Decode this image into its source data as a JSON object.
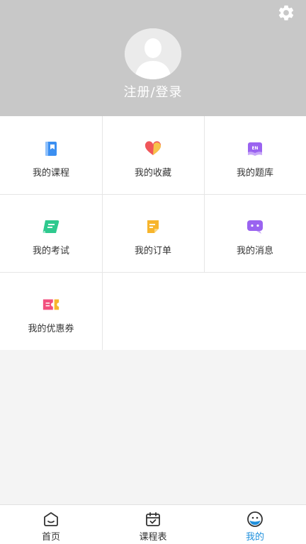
{
  "header": {
    "login_text": "注册/登录"
  },
  "grid": {
    "items": [
      {
        "label": "我的课程",
        "icon": "book-icon",
        "color": "#3b8ff1"
      },
      {
        "label": "我的收藏",
        "icon": "heart-icon",
        "color": "#f0565a"
      },
      {
        "label": "我的题库",
        "icon": "question-bank-icon",
        "color": "#9a63f0"
      },
      {
        "label": "我的考试",
        "icon": "exam-scroll-icon",
        "color": "#2ec98e"
      },
      {
        "label": "我的订单",
        "icon": "order-note-icon",
        "color": "#f7b52c"
      },
      {
        "label": "我的消息",
        "icon": "message-bubble-icon",
        "color": "#9a63f0"
      },
      {
        "label": "我的优惠券",
        "icon": "coupon-icon",
        "color": "#f24f7d"
      }
    ],
    "bank_icon_text": "EN"
  },
  "tabbar": {
    "tabs": [
      {
        "label": "首页",
        "icon": "home-icon"
      },
      {
        "label": "课程表",
        "icon": "calendar-icon"
      },
      {
        "label": "我的",
        "icon": "profile-face-icon"
      }
    ],
    "active_index": 2,
    "active_color": "#1e8fdc"
  }
}
